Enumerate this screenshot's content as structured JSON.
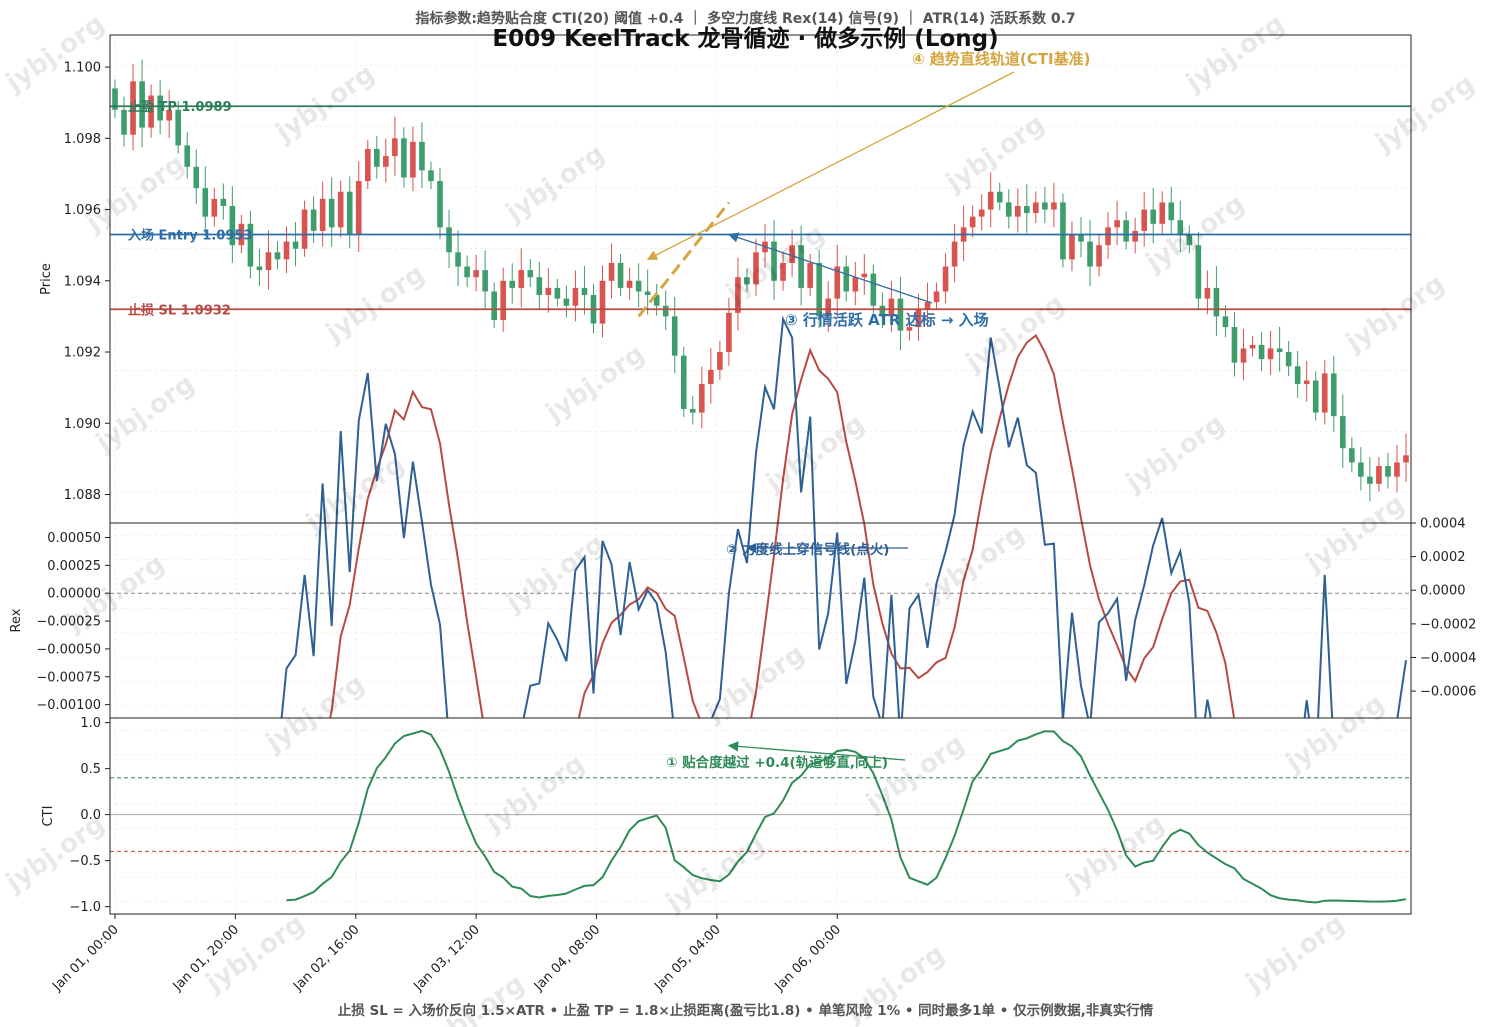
{
  "header": {
    "params_text": "指标参数:趋势贴合度 CTI(20) 阈值 +0.4 ｜ 多空力度线 Rex(14) 信号(9) ｜ ATR(14) 活跃系数 0.7",
    "title": "E009 KeelTrack 龙骨循迹 · 做多示例 (Long)"
  },
  "footer": {
    "text": "止损 SL = 入场价反向 1.5×ATR • 止盈 TP = 1.8×止损距离(盈亏比1.8) • 单笔风险 1% • 同时最多1单 • 仅示例数据,非真实行情"
  },
  "watermark": "jybj.org",
  "colors": {
    "up": "#d9534f",
    "down": "#3f9d6b",
    "tp": "#2e7d5a",
    "entry": "#2e6ea6",
    "sl": "#b84a42",
    "rex": "#2e6096",
    "signal": "#b84a42",
    "cti": "#2e8b57",
    "trend": "#d4a640",
    "annot_atr": "#2e6ea6"
  },
  "chart_data": {
    "type": "candlestick",
    "x_start": "2024-01-01 00:00",
    "x_step_hours": 1.5,
    "xticks": [
      "Jan 01, 00:00",
      "Jan 01, 20:00",
      "Jan 02, 16:00",
      "Jan 03, 12:00",
      "Jan 04, 08:00",
      "Jan 05, 04:00",
      "Jan 06, 00:00"
    ],
    "price_panel": {
      "ylabel": "Price",
      "ylim": [
        1.0872,
        1.1009
      ],
      "yticks": [
        "1.088",
        "1.090",
        "1.092",
        "1.094",
        "1.096",
        "1.098",
        "1.100"
      ],
      "levels": [
        {
          "name": "tp",
          "label": "止盈 TP 1.0989",
          "value": 1.0989
        },
        {
          "name": "entry",
          "label": "入场 Entry 1.0953",
          "value": 1.0953
        },
        {
          "name": "sl",
          "label": "止损 SL 1.0932",
          "value": 1.0932
        }
      ],
      "trend_line": {
        "from": [
          58,
          1.093
        ],
        "to": [
          68,
          1.0962
        ]
      },
      "annotations": [
        {
          "name": "trend",
          "text": "④ 趋势直线轨道(CTI基准)",
          "anchor": [
            59,
            1.0946
          ]
        },
        {
          "name": "atr",
          "text": "③ 行情活跃 ATR 达标 → 入场",
          "anchor": [
            68,
            1.0953
          ]
        }
      ],
      "closes": [
        1.0988,
        1.0981,
        1.0996,
        1.0983,
        1.0992,
        1.0985,
        1.0988,
        1.0978,
        1.0972,
        1.0966,
        1.0958,
        1.0963,
        1.0961,
        1.095,
        1.0956,
        1.0944,
        1.0943,
        1.0948,
        1.0946,
        1.0951,
        1.0949,
        1.096,
        1.0954,
        1.0963,
        1.0955,
        1.0965,
        1.0953,
        1.0968,
        1.0977,
        1.0972,
        1.0975,
        1.098,
        1.0969,
        1.0979,
        1.0971,
        1.0968,
        1.0955,
        1.0948,
        1.0944,
        1.0941,
        1.0943,
        1.0937,
        1.0929,
        1.094,
        1.0938,
        1.0943,
        1.0941,
        1.0936,
        1.0938,
        1.0935,
        1.0933,
        1.0938,
        1.0936,
        1.0928,
        1.094,
        1.0945,
        1.0938,
        1.094,
        1.0937,
        1.0936,
        1.0933,
        1.093,
        1.0919,
        1.0904,
        1.0903,
        1.0911,
        1.0915,
        1.092,
        1.0931,
        1.0941,
        1.0939,
        1.0948,
        1.0951,
        1.094,
        1.0945,
        1.095,
        1.0938,
        1.0945,
        1.093,
        1.0935,
        1.0944,
        1.0937,
        1.0941,
        1.0942,
        1.0933,
        1.093,
        1.0935,
        1.0926,
        1.0927,
        1.0932,
        1.0934,
        1.0937,
        1.0944,
        1.0951,
        1.0955,
        1.0958,
        1.096,
        1.0965,
        1.0962,
        1.0958,
        1.0961,
        1.0959,
        1.0962,
        1.096,
        1.0962,
        1.0946,
        1.0953,
        1.0951,
        1.0944,
        1.095,
        1.0955,
        1.0957,
        1.0951,
        1.0954,
        1.096,
        1.0956,
        1.0962,
        1.0957,
        1.0953,
        1.095,
        1.0935,
        1.0938,
        1.093,
        1.0927,
        1.0917,
        1.0921,
        1.0922,
        1.0918,
        1.0921,
        1.092,
        1.0916,
        1.0911,
        1.0912,
        1.0903,
        1.0914,
        1.0902,
        1.0893,
        1.0889,
        1.0885,
        1.0883,
        1.0888,
        1.0885,
        1.0889,
        1.0891
      ]
    },
    "rex_panel": {
      "ylabel": "Rex",
      "ylim": [
        -0.00112,
        0.00063
      ],
      "yticks": [
        "0.00050",
        "0.00025",
        "0.00000",
        "−0.00025",
        "−0.00050",
        "−0.00075",
        "−0.00100"
      ],
      "right_ylim": [
        -0.00076,
        0.0004
      ],
      "right_yticks": [
        "0.0004",
        "0.0002",
        "0.0000",
        "−0.0002",
        "−0.0004",
        "−0.0006"
      ],
      "annotation": "② 力度线上穿信号线(点火)",
      "annotation_target": [
        70,
        0.00038
      ]
    },
    "cti_panel": {
      "ylabel": "CTI",
      "ylim": [
        -1.08,
        1.05
      ],
      "yticks": [
        "1.0",
        "0.5",
        "0.0",
        "−0.5",
        "−1.0"
      ],
      "threshold_up": 0.4,
      "threshold_down": -0.4,
      "annotation": "① 贴合度越过 +0.4(轨道够直,向上)",
      "annotation_target": [
        68,
        0.75
      ]
    }
  }
}
